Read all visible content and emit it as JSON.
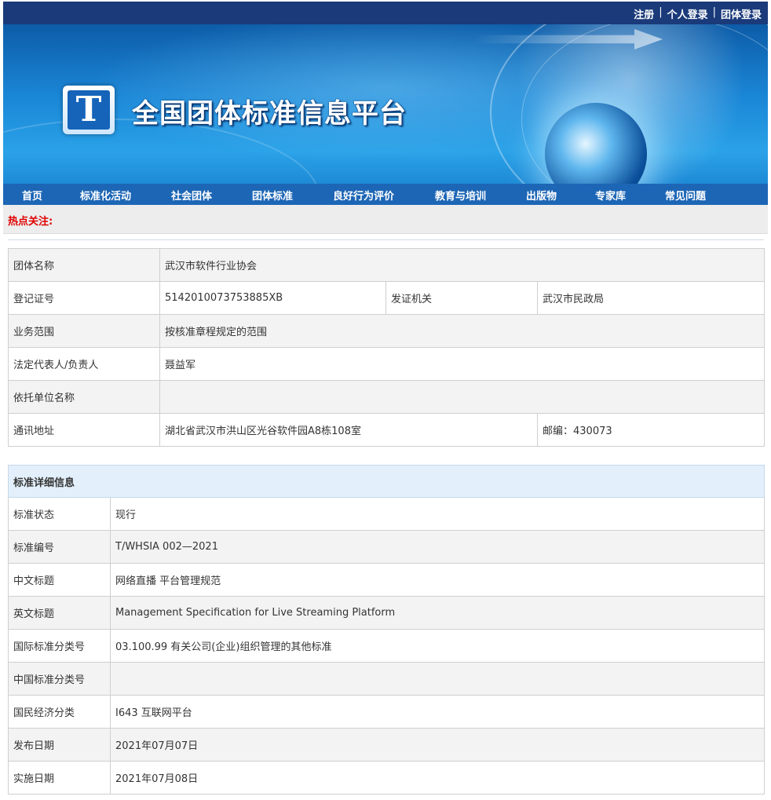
{
  "top_links": [
    "注册",
    "个人登录",
    "团体登录"
  ],
  "site": {
    "title": "全国团体标准信息平台",
    "logo_glyph": "T"
  },
  "nav": [
    "首页",
    "标准化活动",
    "社会团体",
    "团体标准",
    "良好行为评价",
    "教育与培训",
    "出版物",
    "专家库",
    "常见问题"
  ],
  "hot_label": "热点关注:",
  "org_table": {
    "rows": [
      {
        "label": "团体名称",
        "value": "武汉市软件行业协会"
      },
      {
        "label": "登记证号",
        "value": "5142010073753885XB",
        "label2": "发证机关",
        "value2": "武汉市民政局"
      },
      {
        "label": "业务范围",
        "value": "按核准章程规定的范围"
      },
      {
        "label": "法定代表人/负责人",
        "value": "聂益军"
      },
      {
        "label": "依托单位名称",
        "value": ""
      },
      {
        "label": "通讯地址",
        "value": "湖北省武汉市洪山区光谷软件园A8栋108室",
        "value2": "邮编：430073"
      }
    ]
  },
  "std_table": {
    "heading": "标准详细信息",
    "rows": [
      {
        "label": "标准状态",
        "value": "现行"
      },
      {
        "label": "标准编号",
        "value": "T/WHSIA 002—2021"
      },
      {
        "label": "中文标题",
        "value": "网络直播 平台管理规范"
      },
      {
        "label": "英文标题",
        "value": "Management Specification for Live Streaming Platform"
      },
      {
        "label": "国际标准分类号",
        "value": "03.100.99 有关公司(企业)组织管理的其他标准"
      },
      {
        "label": "中国标准分类号",
        "value": ""
      },
      {
        "label": "国民经济分类",
        "value": "I643 互联网平台"
      },
      {
        "label": "发布日期",
        "value": "2021年07月07日"
      },
      {
        "label": "实施日期",
        "value": "2021年07月08日"
      }
    ]
  },
  "colors": {
    "topbar": "#1a3a7a",
    "nav": "#1d66b6",
    "hot_label": "#e00000",
    "table_head": "#e3f0fb"
  }
}
